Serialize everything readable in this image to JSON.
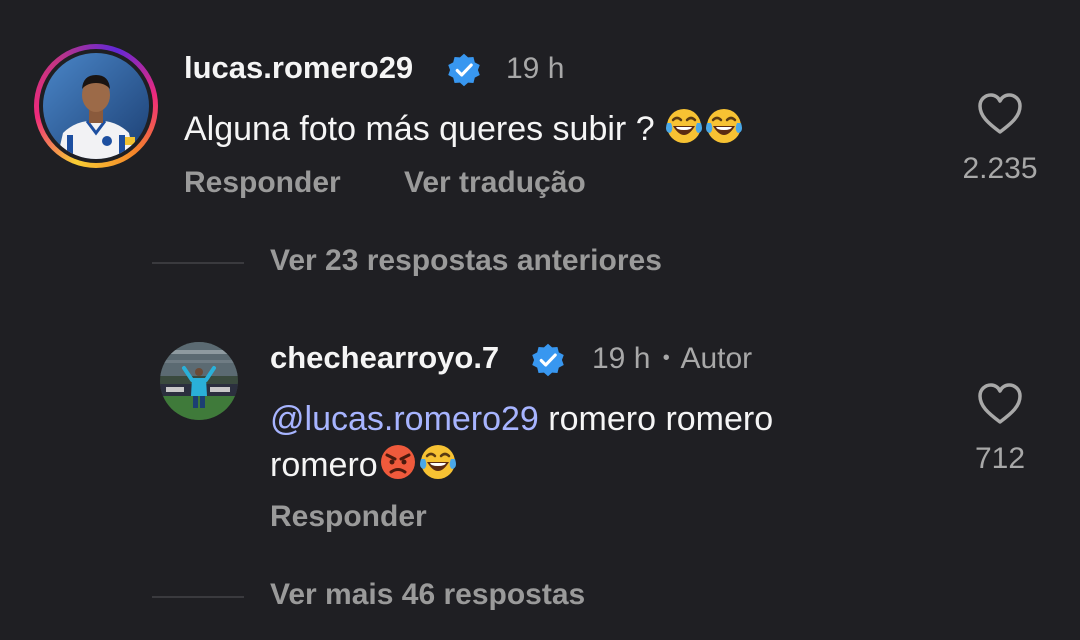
{
  "comment_main": {
    "username": "lucas.romero29",
    "time": "19 h",
    "text": "Alguna foto más queres subir ?",
    "emoji": [
      "face-with-tears-of-joy",
      "face-with-tears-of-joy"
    ],
    "reply_label": "Responder",
    "translate_label": "Ver tradução",
    "likes": "2.235"
  },
  "thread": {
    "previous_replies": "Ver 23 respostas anteriores",
    "more_replies": "Ver mais 46 respostas"
  },
  "comment_reply": {
    "username": "chechearroyo.7",
    "time": "19 h",
    "separator": "•",
    "author_badge": "Autor",
    "mention": "@lucas.romero29",
    "text_line1": " romero romero",
    "text_line2": "romero",
    "emoji": [
      "pouting-face",
      "face-with-tears-of-joy"
    ],
    "reply_label": "Responder",
    "likes": "712"
  },
  "colors": {
    "background": "#1f1f23",
    "verified": "#3897f0",
    "mention": "#a7b4ff",
    "muted": "#a8a8a8"
  }
}
